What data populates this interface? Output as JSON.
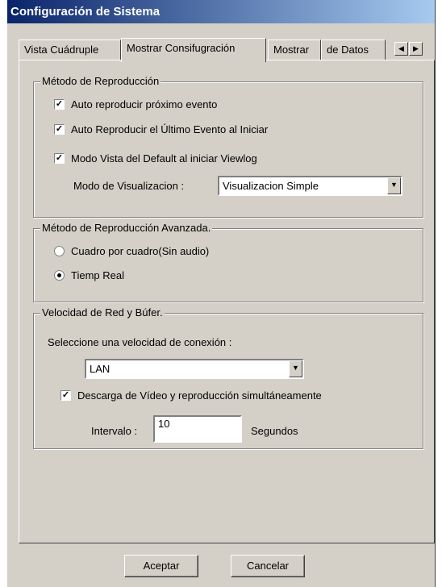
{
  "window": {
    "title": "Configuración de Sistema"
  },
  "tabs": [
    {
      "label": "Vista Cuádruple"
    },
    {
      "label": "Mostrar Consifugración"
    },
    {
      "label": "Mostrar"
    },
    {
      "label": "de Datos"
    }
  ],
  "playback": {
    "legend": "Método de Reproducción",
    "auto_next": {
      "label": "Auto reproducir próximo evento",
      "checked": true
    },
    "auto_last": {
      "label": "Auto Reproducir el Último Evento al Iniciar",
      "checked": true
    },
    "default_view": {
      "label": "Modo Vista del Default al iniciar Viewlog",
      "checked": true
    },
    "view_mode_label": "Modo de Visualizacion :",
    "view_mode_value": "Visualizacion Simple"
  },
  "advanced": {
    "legend": "Método de Reproducción Avanzada.",
    "frame_by_frame": {
      "label": "Cuadro por cuadro(Sin audio)",
      "selected": false
    },
    "real_time": {
      "label": "Tiemp Real",
      "selected": true
    }
  },
  "network": {
    "legend": "Velocidad de Red y Búfer.",
    "speed_label": "Seleccione una velocidad de conexión :",
    "speed_value": "LAN",
    "simultaneous": {
      "label": "Descarga de Vídeo y reproducción simultáneamente",
      "checked": true
    },
    "interval_label": "Intervalo :",
    "interval_value": "10",
    "interval_unit": "Segundos"
  },
  "buttons": {
    "ok": "Aceptar",
    "cancel": "Cancelar"
  },
  "icons": {
    "checkmark": "check-icon",
    "scroll_left": "arrow-left-icon",
    "scroll_right": "arrow-right-icon",
    "dropdown": "chevron-down-icon"
  }
}
